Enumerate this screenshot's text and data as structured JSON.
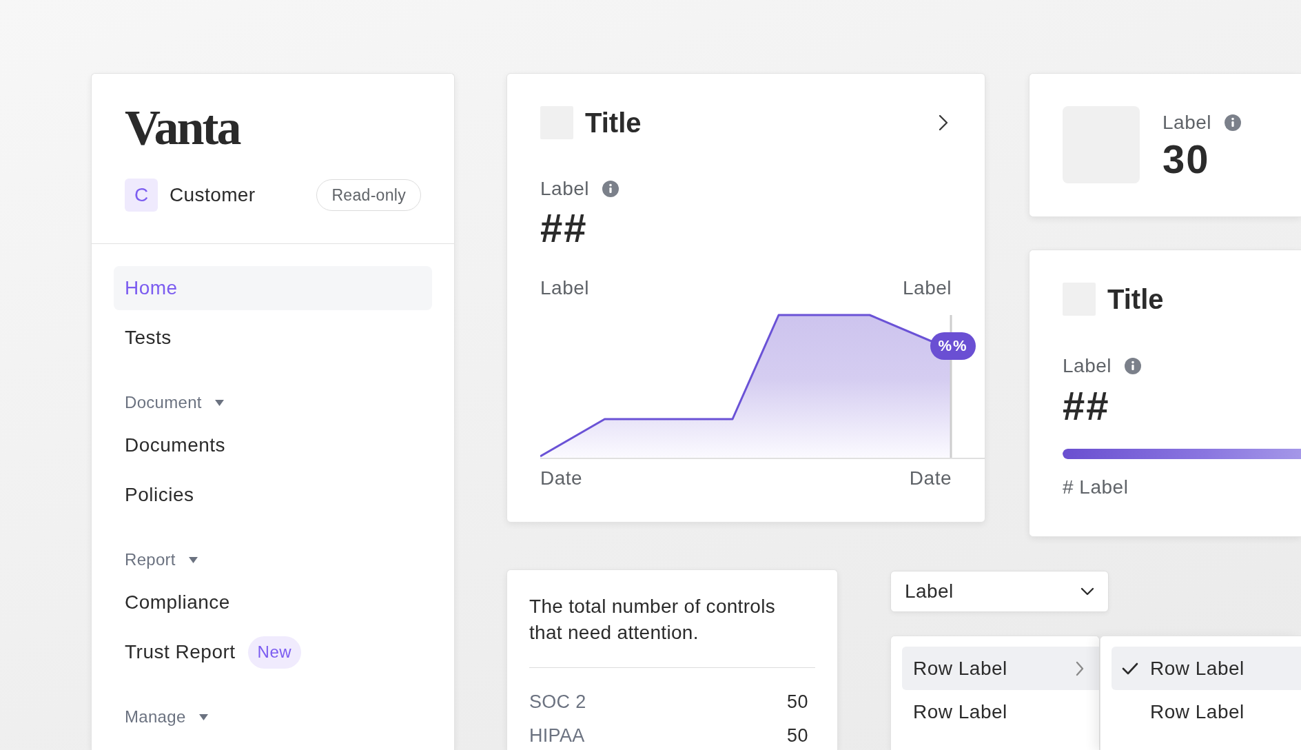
{
  "sidebar": {
    "logo": "Vanta",
    "workspace": {
      "initial": "C",
      "name": "Customer",
      "badge": "Read-only"
    },
    "items": [
      {
        "label": "Home",
        "selected": true
      },
      {
        "label": "Tests",
        "selected": false
      }
    ],
    "sections": [
      {
        "title": "Document",
        "expanded": true,
        "items": [
          {
            "label": "Documents",
            "selected": false
          },
          {
            "label": "Policies",
            "selected": false
          }
        ]
      },
      {
        "title": "Report",
        "expanded": true,
        "items": [
          {
            "label": "Compliance",
            "selected": false
          },
          {
            "label": "Trust Report",
            "selected": false,
            "badge": "New"
          }
        ]
      },
      {
        "title": "Manage",
        "expanded": true
      }
    ]
  },
  "chart_card": {
    "title": "Title",
    "metric_label": "Label",
    "metric_value": "##",
    "chart_labels": [
      "Label",
      "Label"
    ],
    "chart_badge": "%%",
    "dates": [
      "Date",
      "Date"
    ]
  },
  "stat_card": {
    "label": "Label",
    "value": "30"
  },
  "progress_card": {
    "title": "Title",
    "metric_label": "Label",
    "metric_value": "##",
    "level": 1,
    "caption": "# Label"
  },
  "summary_card": {
    "description": "The total number of controls that need attention.",
    "rows": [
      {
        "name": "SOC 2",
        "value": "50"
      },
      {
        "name": "HIPAA",
        "value": "50"
      }
    ]
  },
  "select": {
    "value": "Label"
  },
  "menus": [
    {
      "items": [
        {
          "label": "Row Label",
          "kind": "submenu",
          "selected": true
        },
        {
          "label": "Row Label",
          "kind": "plain",
          "selected": false
        }
      ]
    },
    {
      "items": [
        {
          "label": "Row Label",
          "kind": "check",
          "checked": true,
          "selected": true
        },
        {
          "label": "Row Label",
          "kind": "check",
          "checked": false,
          "selected": false
        }
      ]
    }
  ]
}
